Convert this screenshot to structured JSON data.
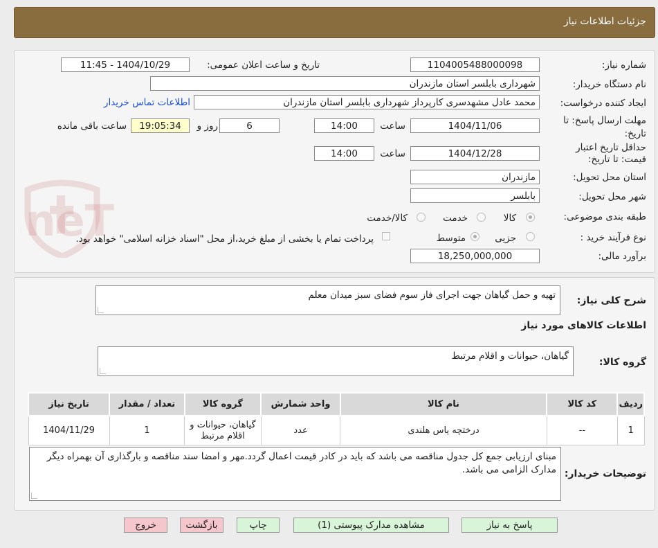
{
  "header": {
    "title": "جزئیات اطلاعات نیاز"
  },
  "watermark": {
    "text": "AriaTender.neT"
  },
  "form": {
    "need_number": {
      "label": "شماره نیاز:",
      "value": "1104005488000098"
    },
    "announce": {
      "label": "تاریخ و ساعت اعلان عمومی:",
      "value": "1404/10/29 - 11:45"
    },
    "buyer_org": {
      "label": "نام دستگاه خریدار:",
      "value": "شهرداری بابلسر استان مازندران"
    },
    "requester": {
      "label": "ایجاد کننده درخواست:",
      "value": "محمد عادل مشهدسری کارپرداز شهرداری بابلسر استان مازندران",
      "contact_link": "اطلاعات تماس خریدار"
    },
    "deadline": {
      "label_1": "مهلت ارسال پاسخ: تا",
      "label_2": "تاریخ:",
      "date": "1404/11/06",
      "time_label": "ساعت",
      "time": "14:00",
      "days": "6",
      "days_label": "روز و",
      "remaining": "19:05:34",
      "remaining_label": "ساعت باقی مانده"
    },
    "validity": {
      "label_1": "حداقل تاریخ اعتبار",
      "label_2": "قیمت: تا تاریخ:",
      "date": "1404/12/28",
      "time_label": "ساعت",
      "time": "14:00"
    },
    "province": {
      "label": "استان محل تحویل:",
      "value": "مازندران"
    },
    "city": {
      "label": "شهر محل تحویل:",
      "value": "بابلسر"
    },
    "category": {
      "label": "طبقه بندی موضوعی:",
      "options": [
        "کالا",
        "خدمت",
        "کالا/خدمت"
      ],
      "selected": "کالا"
    },
    "process": {
      "label": "نوع فرآیند خرید :",
      "options": [
        "جزیی",
        "متوسط"
      ],
      "selected": "متوسط",
      "payment_note": "پرداخت تمام یا بخشی از مبلغ خرید،از محل \"اسناد خزانه اسلامی\" خواهد بود."
    },
    "budget": {
      "label": "برآورد مالی:",
      "value": "18,250,000,000"
    }
  },
  "summary": {
    "label": "شرح کلی نیاز:",
    "value": "تهیه و حمل گیاهان جهت اجرای فاز سوم فضای سبز میدان معلم"
  },
  "goods_info": {
    "title": "اطلاعات کالاهای مورد نیاز"
  },
  "goods_group": {
    "label": "گروه کالا:",
    "value": "گیاهان، حیوانات و اقلام مرتبط"
  },
  "table": {
    "headers": [
      "ردیف",
      "کد کالا",
      "نام کالا",
      "واحد شمارش",
      "گروه کالا",
      "تعداد / مقدار",
      "تاریخ نیاز"
    ],
    "rows": [
      [
        "1",
        "--",
        "درختچه یاس هلندی",
        "عدد",
        "گیاهان، حیوانات و اقلام مرتبط",
        "1",
        "1404/11/29"
      ]
    ]
  },
  "buyer_notes": {
    "label": "توضیحات خریدار:",
    "value": "مبنای ارزیابی جمع کل جدول مناقصه می باشد که باید در کادر قیمت اعمال گردد.مهر و امضا سند مناقصه و بارگذاری آن بهمراه دیگر مدارک الزامی می باشد."
  },
  "buttons": {
    "reply": "پاسخ به نیاز",
    "attachments": "مشاهده مدارک پیوستی (1)",
    "print": "چاپ",
    "back": "بازگشت",
    "exit": "خروج"
  },
  "colors": {
    "header_bg": "#8a6d3f",
    "button_green": "#d9f5d9",
    "button_pink": "#f5c6cb",
    "link": "#1a4fd6",
    "highlight": "#ffffcc"
  }
}
